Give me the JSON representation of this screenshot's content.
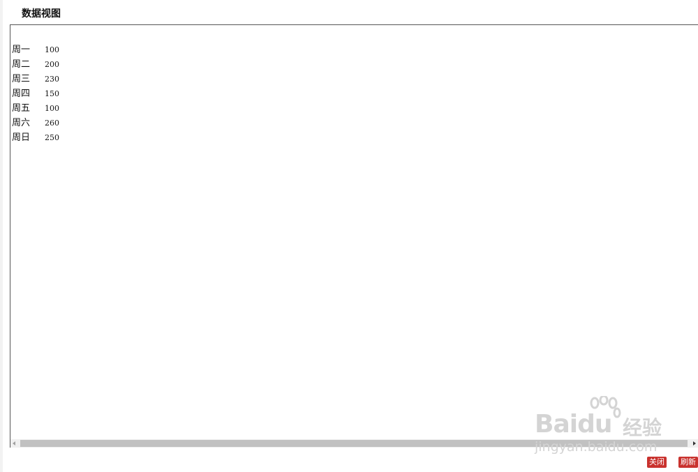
{
  "title": "数据视图",
  "rows": [
    {
      "day": "周一",
      "value": "100"
    },
    {
      "day": "周二",
      "value": "200"
    },
    {
      "day": "周三",
      "value": "230"
    },
    {
      "day": "周四",
      "value": "150"
    },
    {
      "day": "周五",
      "value": "100"
    },
    {
      "day": "周六",
      "value": "260"
    },
    {
      "day": "周日",
      "value": "250"
    }
  ],
  "buttons": {
    "close_label": "关闭",
    "refresh_label": "刷新"
  },
  "watermark": {
    "brand": "Baidu",
    "brand_cn": "经验",
    "url": "jingyan.baidu.com"
  }
}
